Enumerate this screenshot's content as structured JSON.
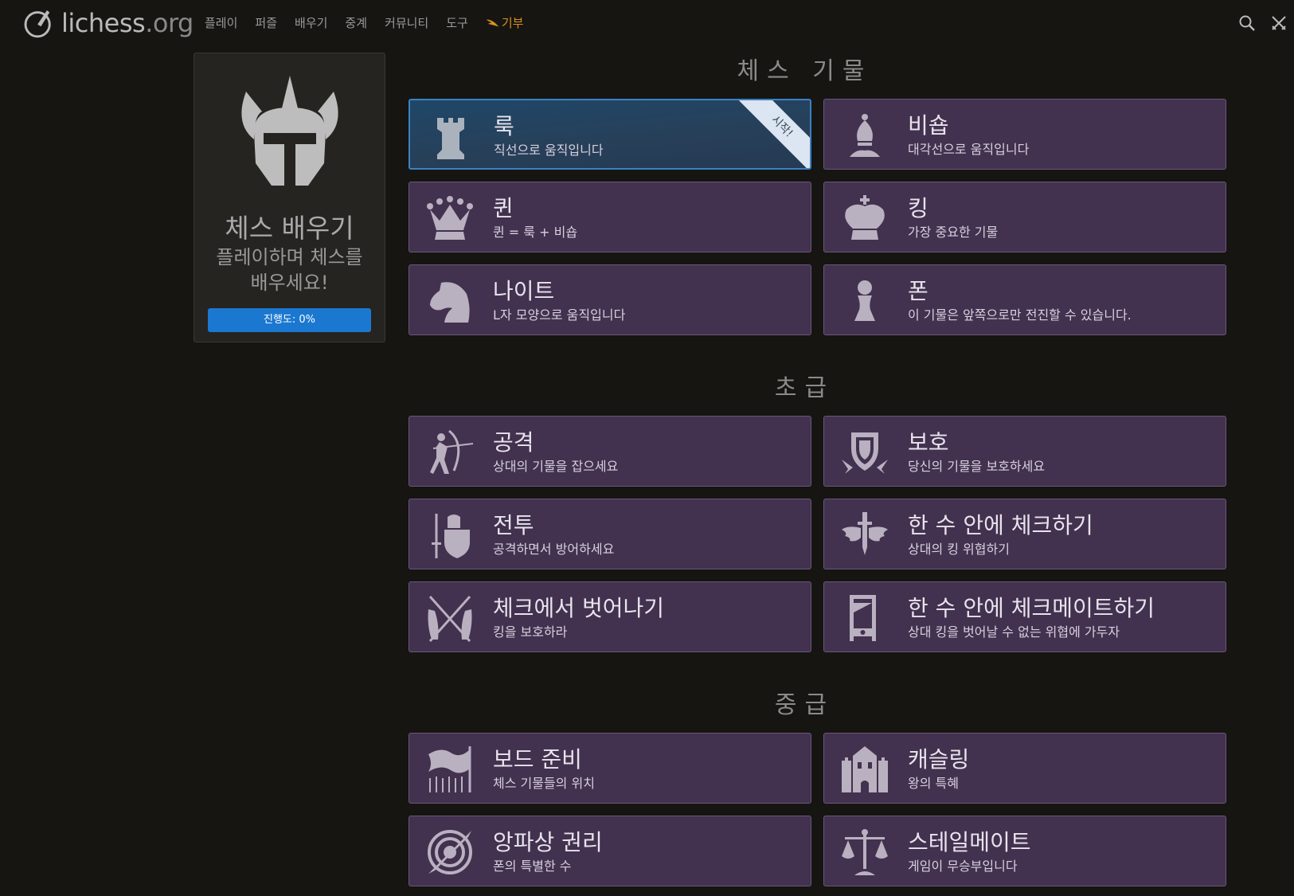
{
  "logo": {
    "name": "lichess",
    "tld": ".org"
  },
  "nav": [
    "플레이",
    "퍼즐",
    "배우기",
    "중계",
    "커뮤니티",
    "도구"
  ],
  "donate_label": "기부",
  "side": {
    "title": "체스 배우기",
    "subtitle": "플레이하며 체스를 배우세요!",
    "progress": "진행도: 0%"
  },
  "sections": [
    {
      "title": "체스 기물"
    },
    {
      "title": "초급"
    },
    {
      "title": "중급"
    }
  ],
  "stages": [
    {
      "name": "룩",
      "desc": "직선으로 움직입니다",
      "icon": "rook-icon"
    },
    {
      "name": "비숍",
      "desc": "대각선으로 움직입니다",
      "icon": "bishop-icon"
    },
    {
      "name": "퀸",
      "desc": "퀸 = 룩 + 비숍",
      "icon": "queen-icon"
    },
    {
      "name": "킹",
      "desc": "가장 중요한 기물",
      "icon": "king-icon"
    },
    {
      "name": "나이트",
      "desc": "L자 모양으로 움직입니다",
      "icon": "knight-icon"
    },
    {
      "name": "폰",
      "desc": "이 기물은 앞쪽으로만 전진할 수 있습니다.",
      "icon": "pawn-icon"
    },
    {
      "name": "공격",
      "desc": "상대의 기물을 잡으세요",
      "icon": "archer-icon"
    },
    {
      "name": "보호",
      "desc": "당신의 기물을 보호하세요",
      "icon": "shield-icon"
    },
    {
      "name": "전투",
      "desc": "공격하면서 방어하세요",
      "icon": "knight-warrior-icon"
    },
    {
      "name": "한 수 안에 체크하기",
      "desc": "상대의 킹 위협하기",
      "icon": "winged-sword-icon"
    },
    {
      "name": "체크에서 벗어나기",
      "desc": "킹을 보호하라",
      "icon": "crossed-spears-icon"
    },
    {
      "name": "한 수 안에 체크메이트하기",
      "desc": "상대 킹을 벗어날 수 없는 위협에 가두자",
      "icon": "guillotine-icon"
    },
    {
      "name": "보드 준비",
      "desc": "체스 기물들의 위치",
      "icon": "flag-army-icon"
    },
    {
      "name": "캐슬링",
      "desc": "왕의 특혜",
      "icon": "castle-icon"
    },
    {
      "name": "앙파상 권리",
      "desc": "폰의 특별한 수",
      "icon": "swirl-icon"
    },
    {
      "name": "스테일메이트",
      "desc": "게임이 무승부입니다",
      "icon": "scales-icon"
    }
  ],
  "active_ribbon": "시작!",
  "colors": {
    "accent": "#1b78d0",
    "stage_bg": "#42314f",
    "active_bg": "#1f4768",
    "donate": "#d59120"
  }
}
